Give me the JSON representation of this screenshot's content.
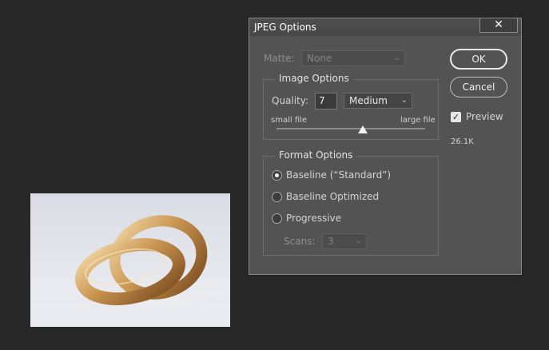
{
  "dialog": {
    "title": "JPEG Options",
    "close_glyph": "✕",
    "matte": {
      "label": "Matte:",
      "value": "None"
    },
    "image_options": {
      "title": "Image Options",
      "quality_label": "Quality:",
      "quality_value": "7",
      "quality_preset": "Medium",
      "slider_left_label": "small file",
      "slider_right_label": "large file",
      "slider_fraction": 0.58
    },
    "format_options": {
      "title": "Format Options",
      "options": [
        {
          "label": "Baseline (“Standard”)",
          "selected": true
        },
        {
          "label": "Baseline Optimized",
          "selected": false
        },
        {
          "label": "Progressive",
          "selected": false
        }
      ],
      "scans_label": "Scans:",
      "scans_value": "3"
    },
    "buttons": {
      "ok": "OK",
      "cancel": "Cancel"
    },
    "preview": {
      "label": "Preview",
      "checked": true
    },
    "file_size": "26.1K"
  },
  "icons": {
    "chevron": "chevron-down-icon",
    "close": "close-icon",
    "check": "check-icon"
  }
}
